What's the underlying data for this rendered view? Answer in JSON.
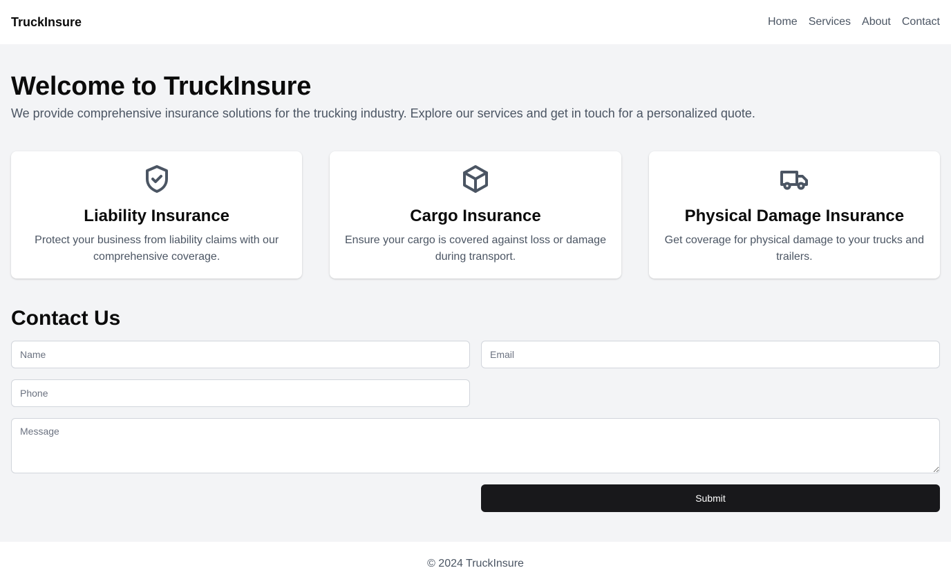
{
  "header": {
    "brand": "TruckInsure",
    "nav": [
      "Home",
      "Services",
      "About",
      "Contact"
    ]
  },
  "hero": {
    "title": "Welcome to TruckInsure",
    "subtitle": "We provide comprehensive insurance solutions for the trucking industry. Explore our services and get in touch for a personalized quote."
  },
  "services": [
    {
      "icon": "shield-check-icon",
      "title": "Liability Insurance",
      "description": "Protect your business from liability claims with our comprehensive coverage."
    },
    {
      "icon": "box-icon",
      "title": "Cargo Insurance",
      "description": "Ensure your cargo is covered against loss or damage during transport."
    },
    {
      "icon": "truck-icon",
      "title": "Physical Damage Insurance",
      "description": "Get coverage for physical damage to your trucks and trailers."
    }
  ],
  "contact": {
    "title": "Contact Us",
    "name_placeholder": "Name",
    "email_placeholder": "Email",
    "phone_placeholder": "Phone",
    "message_placeholder": "Message",
    "submit_label": "Submit"
  },
  "footer": {
    "text": "© 2024 TruckInsure"
  },
  "colors": {
    "background": "#f3f4f6",
    "surface": "#ffffff",
    "primary_button": "#18181b",
    "muted_text": "#4b5563",
    "icon": "#4b5563"
  }
}
